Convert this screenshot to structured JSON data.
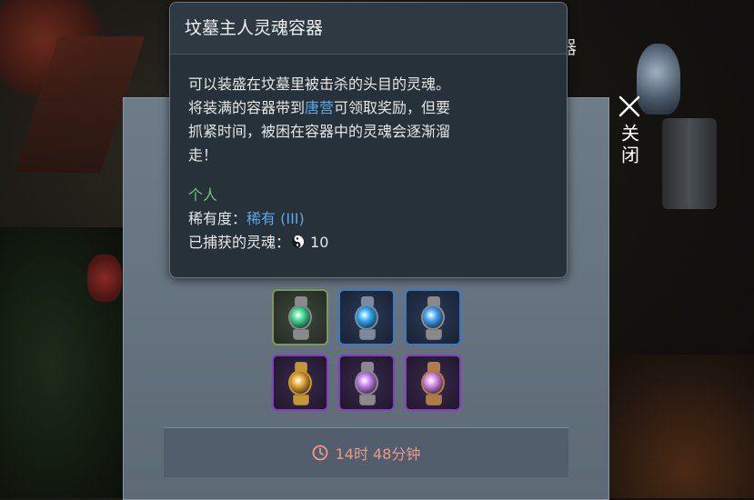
{
  "background": {
    "partial_text": "器"
  },
  "tooltip": {
    "title": "坟墓主人灵魂容器",
    "description_lines": {
      "l1": "可以装盛在坟墓里被击杀的头目的灵魂。",
      "l2_pre": "将装满的容器带到",
      "l2_link": "唐营",
      "l2_post": "可领取奖励，但要",
      "l3": "抓紧时间，被困在容器中的灵魂会逐渐溜",
      "l4": "走！"
    },
    "binding": "个人",
    "rarity_label": "稀有度：",
    "rarity_value": "稀有 (III)",
    "souls_label": "已捕获的灵魂：",
    "souls_value": "10"
  },
  "close": {
    "label": "关闭"
  },
  "slots": [
    {
      "rarity": "uncommon",
      "orb": "#3ad48a",
      "metal": "#8a8a8a"
    },
    {
      "rarity": "rare",
      "orb": "#2aa8f0",
      "metal": "#7a8aa0"
    },
    {
      "rarity": "rare",
      "orb": "#3aa0f0",
      "metal": "#8a8a8a"
    },
    {
      "rarity": "epic",
      "orb": "#e0a02a",
      "metal": "#c8962a"
    },
    {
      "rarity": "epic",
      "orb": "#c07ae8",
      "metal": "#8a8a8a"
    },
    {
      "rarity": "epic",
      "orb": "#d080e0",
      "metal": "#b87a3a"
    }
  ],
  "timer": {
    "text": "14时 48分钟"
  },
  "colors": {
    "accent_blue": "#5aa8e8",
    "accent_green": "#6cc86c",
    "timer_text": "#e89a8a"
  }
}
